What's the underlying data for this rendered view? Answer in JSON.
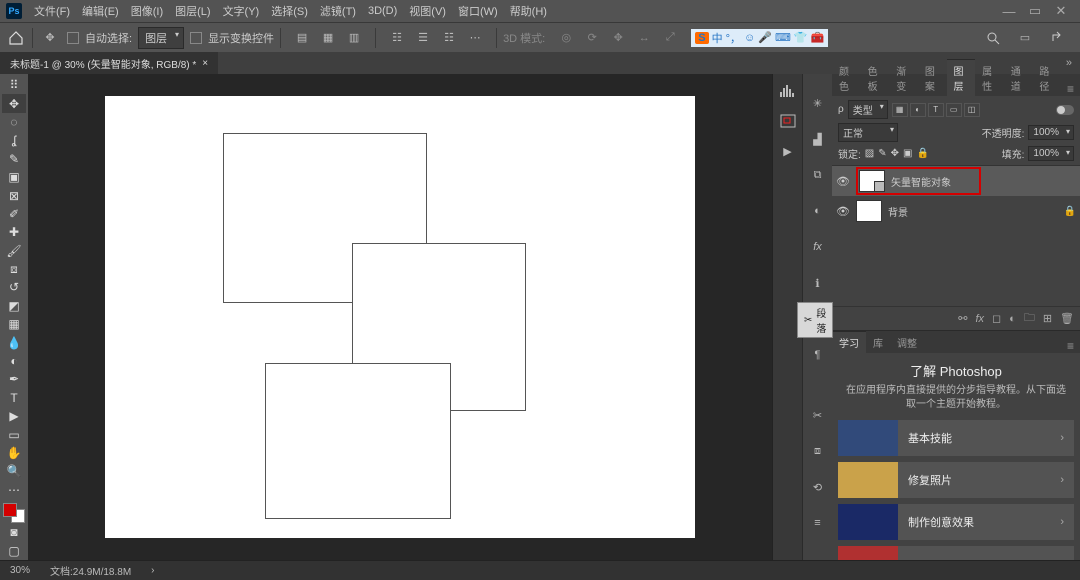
{
  "app": {
    "ps_badge": "Ps"
  },
  "menu": {
    "file": "文件(F)",
    "edit": "编辑(E)",
    "image": "图像(I)",
    "layer": "图层(L)",
    "type": "文字(Y)",
    "select": "选择(S)",
    "filter": "滤镜(T)",
    "td": "3D(D)",
    "view": "视图(V)",
    "window": "窗口(W)",
    "help": "帮助(H)"
  },
  "options": {
    "auto_select": "自动选择:",
    "auto_select_mode": "图层",
    "show_transform": "显示变换控件",
    "td_mode": "3D 模式:"
  },
  "ime": {
    "badge": "S",
    "chinese": "中"
  },
  "doc_tab": {
    "label": "未标题-1 @ 30% (矢量智能对象, RGB/8) *"
  },
  "panels": {
    "color_tabs": {
      "color": "颜色",
      "swatches": "色板",
      "gradients": "渐变",
      "patterns": "图案",
      "layers": "图层",
      "properties": "属性",
      "channels": "通道",
      "paths": "路径"
    },
    "layer_filter_kind": "类型",
    "blend_mode": "正常",
    "opacity_label": "不透明度:",
    "opacity_value": "100%",
    "lock_label": "锁定:",
    "fill_label": "填充:",
    "fill_value": "100%",
    "layers": [
      {
        "name": "矢量智能对象",
        "selected": true,
        "smart": true
      },
      {
        "name": "背景",
        "selected": false,
        "locked": true
      }
    ]
  },
  "paragraph_float": "段落",
  "learn": {
    "tabs": {
      "learn": "学习",
      "library": "库",
      "adjust": "调整"
    },
    "title": "了解 Photoshop",
    "subtitle": "在应用程序内直接提供的分步指导教程。从下面选取一个主题开始教程。",
    "items": [
      "基本技能",
      "修复照片",
      "制作创意效果"
    ]
  },
  "status": {
    "zoom": "30%",
    "docinfo": "文档:24.9M/18.8M"
  }
}
